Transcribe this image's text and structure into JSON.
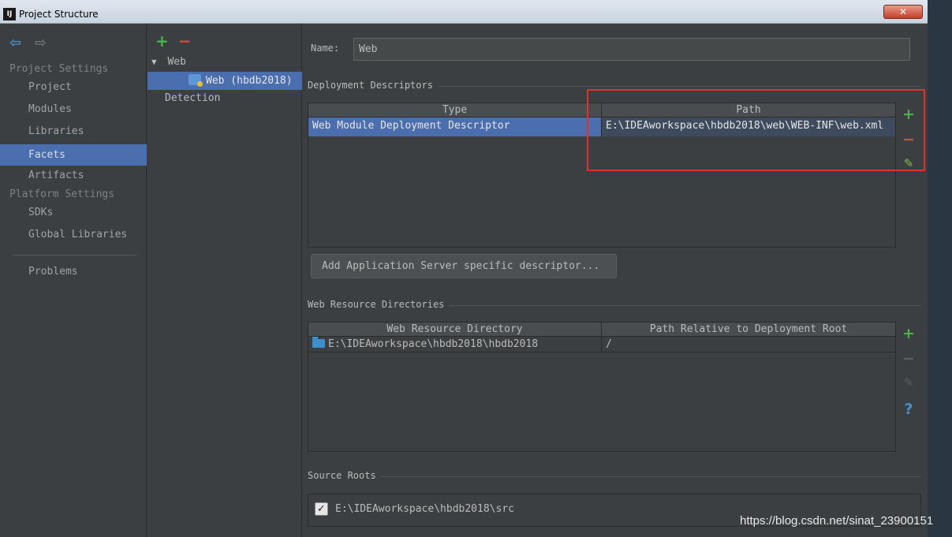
{
  "window": {
    "title": "Project Structure",
    "close_label": "✕"
  },
  "sidebar": {
    "project_settings_label": "Project Settings",
    "platform_settings_label": "Platform Settings",
    "items": [
      {
        "label": "Project"
      },
      {
        "label": "Modules"
      },
      {
        "label": "Libraries"
      },
      {
        "label": "Facets",
        "selected": true
      },
      {
        "label": "Artifacts"
      },
      {
        "label": "SDKs"
      },
      {
        "label": "Global Libraries"
      },
      {
        "label": "Problems"
      }
    ]
  },
  "tree": {
    "group_label": "Web",
    "facet_label": "Web (hbdb2018)",
    "detection_label": "Detection"
  },
  "details": {
    "name_label": "Name:",
    "name_value": "Web",
    "deployment_descriptors": {
      "title": "Deployment Descriptors",
      "columns": [
        "Type",
        "Path"
      ],
      "rows": [
        {
          "type": "Web Module Deployment Descriptor",
          "path": "E:\\IDEAworkspace\\hbdb2018\\web\\WEB-INF\\web.xml"
        }
      ]
    },
    "add_descriptor_button": "Add Application Server specific descriptor...",
    "web_resource_directories": {
      "title": "Web Resource Directories",
      "columns": [
        "Web Resource Directory",
        "Path Relative to Deployment Root"
      ],
      "rows": [
        {
          "directory": "E:\\IDEAworkspace\\hbdb2018\\hbdb2018",
          "relative": "/"
        }
      ]
    },
    "source_roots": {
      "title": "Source Roots",
      "items": [
        {
          "path": "E:\\IDEAworkspace\\hbdb2018\\src",
          "checked": true
        }
      ]
    }
  },
  "watermark": "https://blog.csdn.net/sinat_23900151",
  "colors": {
    "selection": "#4b6eaf",
    "background": "#3c3f41",
    "add": "#4cb04c",
    "remove": "#d8493d",
    "highlight": "#e03131"
  }
}
